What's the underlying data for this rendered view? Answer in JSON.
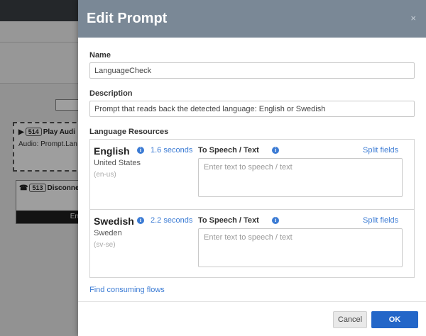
{
  "background": {
    "node1": {
      "id": "514",
      "title": "Play Audi",
      "subtitle": "Audio: Prompt.Lan"
    },
    "node2": {
      "id": "513",
      "title": "Disconne",
      "bar_text": "En"
    }
  },
  "modal": {
    "title": "Edit Prompt",
    "close_icon": "×",
    "name_label": "Name",
    "name_value": "LanguageCheck",
    "description_label": "Description",
    "description_value": "Prompt that reads back the detected language: English or Swedish",
    "resources_label": "Language Resources",
    "languages": [
      {
        "name": "English",
        "country": "United States",
        "code": "(en-us)",
        "duration": "1.6 seconds",
        "tts_label": "To Speech / Text",
        "split_label": "Split fields",
        "tts_placeholder": "Enter text to speech / text"
      },
      {
        "name": "Swedish",
        "country": "Sweden",
        "code": "(sv-se)",
        "duration": "2.2 seconds",
        "tts_label": "To Speech / Text",
        "split_label": "Split fields",
        "tts_placeholder": "Enter text to speech / text"
      }
    ],
    "find_link": "Find consuming flows",
    "cancel_label": "Cancel",
    "ok_label": "OK"
  },
  "colors": {
    "header_bg": "#7a8896",
    "link": "#3b7bd4",
    "primary_button": "#2366c8"
  }
}
